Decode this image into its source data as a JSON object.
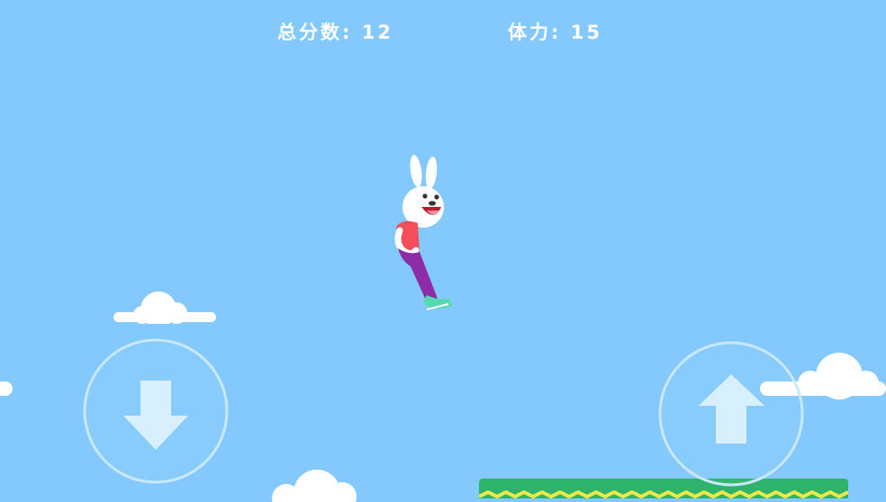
{
  "hud": {
    "score_label": "总分数:",
    "score_value": "12",
    "stamina_label": "体力:",
    "stamina_value": "15"
  },
  "controls": {
    "down_icon": "arrow-down-icon",
    "up_icon": "arrow-up-icon"
  },
  "colors": {
    "sky": "#84c9fd",
    "cloud": "#ffffff",
    "platform_green": "#2db36b",
    "platform_zigzag": "#f2e84a",
    "control_fill": "#d8effd",
    "control_ring": "#c9e8fb"
  }
}
